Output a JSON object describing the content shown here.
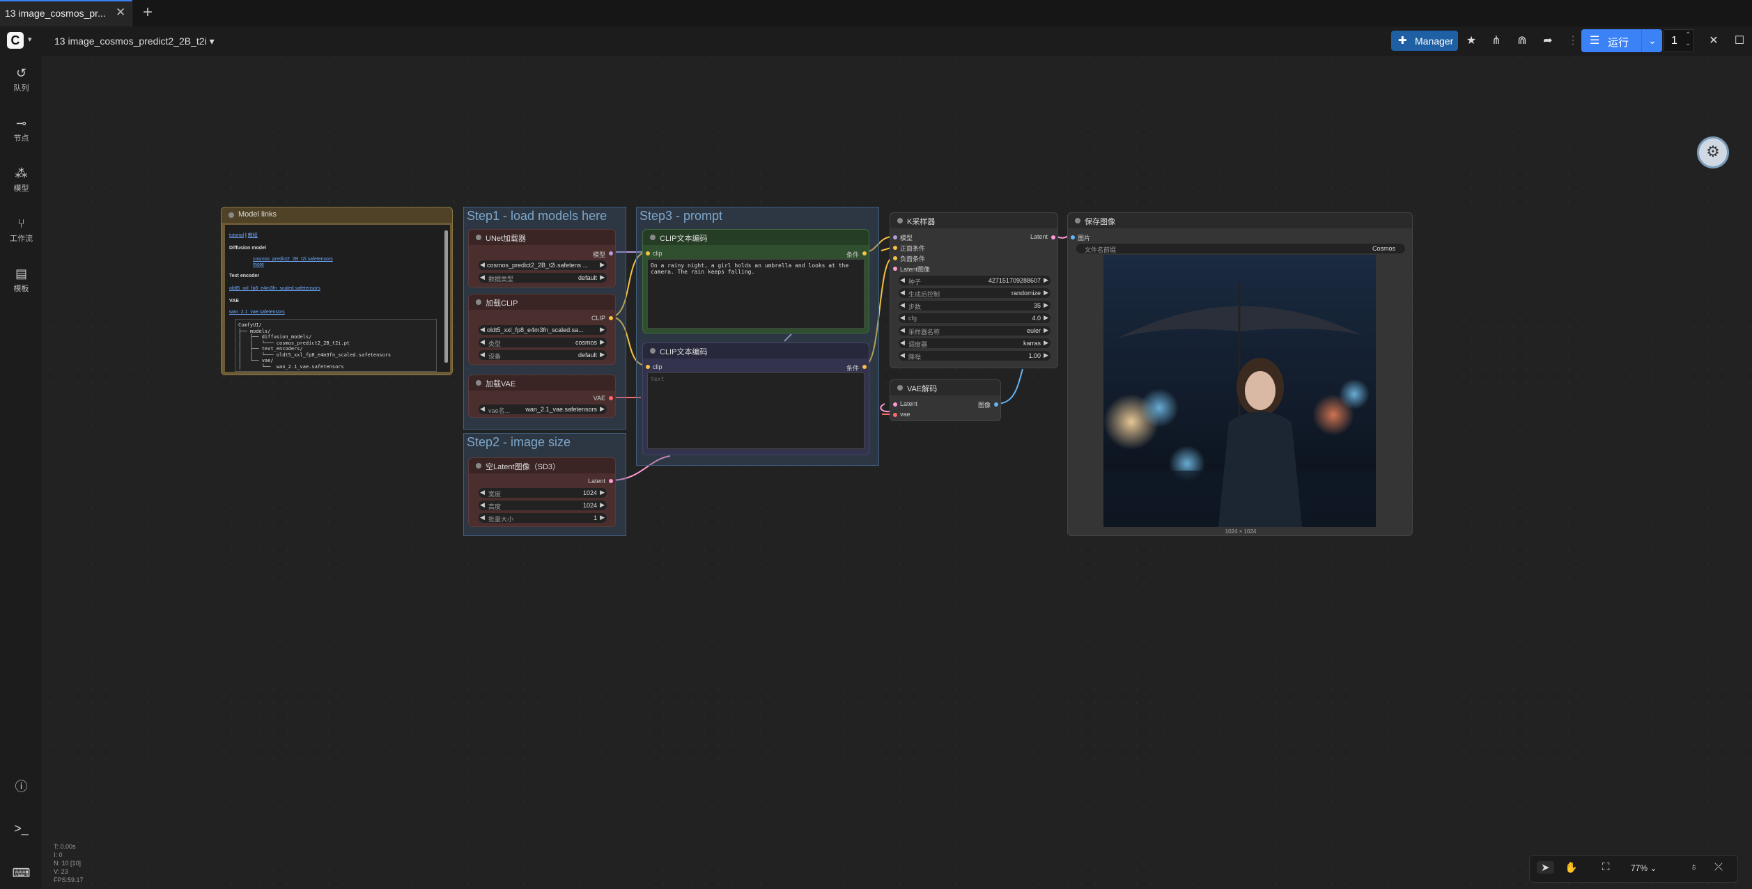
{
  "tabs": [
    {
      "label": "13 image_cosmos_pr...",
      "close": "✕"
    }
  ],
  "new_tab_icon": "+",
  "topbar": {
    "workflow_title": "13 image_cosmos_predict2_2B_t2i",
    "manager_label": "Manager",
    "run_label": "运行",
    "queue_count": "1"
  },
  "sidebar": {
    "items": [
      {
        "label": "队列",
        "icon": "history-icon"
      },
      {
        "label": "节点",
        "icon": "node-icon"
      },
      {
        "label": "模型",
        "icon": "model-icon"
      },
      {
        "label": "工作流",
        "icon": "workflow-icon"
      },
      {
        "label": "模板",
        "icon": "template-icon"
      }
    ]
  },
  "groups": {
    "step1": "Step1 - load models here",
    "step2": "Step2 - image size",
    "step3": "Step3 - prompt"
  },
  "model_links": {
    "title": "Model links",
    "links_tutorial": "tutorial",
    "links_sep": " | ",
    "links_other": "教程",
    "diffusion_heading": "Diffusion model",
    "diffusion_file": "cosmos_predict2_2B_t2i.safetensors",
    "diffusion_more": "more",
    "text_encoder_heading": "Text encoder",
    "text_encoder_file": "oldt5_xxl_fp8_e4m3fn_scaled.safetensors",
    "vae_heading": "VAE",
    "vae_file": "wan_2.1_vae.safetensors",
    "tree": "ComfyUI/\n├── models/\n│   ├── diffusion_models/\n│   │   └─── cosmos_predict2_2B_t2i.pt\n│   ├── text_encoders/\n│   │   └─── oldt5_xxl_fp8_e4m3fn_scaled.safetensors\n│   └── vae/\n│       └──  wan_2.1_vae.safetensors"
  },
  "unet_node": {
    "title": "UNet加载器",
    "out_label": "模型",
    "w1_value": "cosmos_predict2_2B_t2i.safetens ...",
    "w2_label": "数据类型",
    "w2_value": "default"
  },
  "clip_loader": {
    "title": "加载CLIP",
    "out_label": "CLIP",
    "w1_value": "oldt5_xxl_fp8_e4m3fn_scaled.sa...",
    "w2_label": "类型",
    "w2_value": "cosmos",
    "w3_label": "设备",
    "w3_value": "default"
  },
  "vae_loader": {
    "title": "加载VAE",
    "out_label": "VAE",
    "w1_label": "vae名...",
    "w1_value": "wan_2.1_vae.safetensors"
  },
  "latent_node": {
    "title": "空Latent图像（SD3）",
    "out_label": "Latent",
    "w1_label": "宽度",
    "w1_value": "1024",
    "w2_label": "高度",
    "w2_value": "1024",
    "w3_label": "批量大小",
    "w3_value": "1"
  },
  "clip_pos": {
    "title": "CLIP文本编码",
    "in_label": "clip",
    "out_label": "条件",
    "text": "On a rainy night, a girl holds an umbrella and looks at the camera. The rain keeps falling."
  },
  "clip_neg": {
    "title": "CLIP文本编码",
    "in_label": "clip",
    "out_label": "条件",
    "placeholder": "text"
  },
  "ksampler": {
    "title": "K采样器",
    "in1": "模型",
    "in2": "正面条件",
    "in3": "负面条件",
    "in4": "Latent图像",
    "out": "Latent",
    "rows": [
      {
        "label": "种子",
        "value": "427151709288607"
      },
      {
        "label": "生成后控制",
        "value": "randomize"
      },
      {
        "label": "步数",
        "value": "35"
      },
      {
        "label": "cfg",
        "value": "4.0"
      },
      {
        "label": "采样器名称",
        "value": "euler"
      },
      {
        "label": "调度器",
        "value": "karras"
      },
      {
        "label": "降噪",
        "value": "1.00"
      }
    ]
  },
  "vae_decode": {
    "title": "VAE解码",
    "in1": "Latent",
    "in2": "vae",
    "out": "图像"
  },
  "save_image": {
    "title": "保存图像",
    "in1": "图片",
    "w1_label": "文件名前缀",
    "w1_value": "Cosmos",
    "caption": "1024 × 1024"
  },
  "stats": [
    "T: 0.00s",
    "I: 0",
    "N: 10 [10]",
    "V: 23",
    "FPS:59.17"
  ],
  "canvas_toolbar": {
    "zoom": "77%"
  },
  "colors": {
    "accent": "#3b82f6",
    "manager": "#1f5fa3",
    "step_group": "#3f5f80",
    "note_node": "#6b5a33",
    "loader_node": "#4b2f2f",
    "clip_pos": "#2f4f2f",
    "clip_neg": "#33334d"
  }
}
